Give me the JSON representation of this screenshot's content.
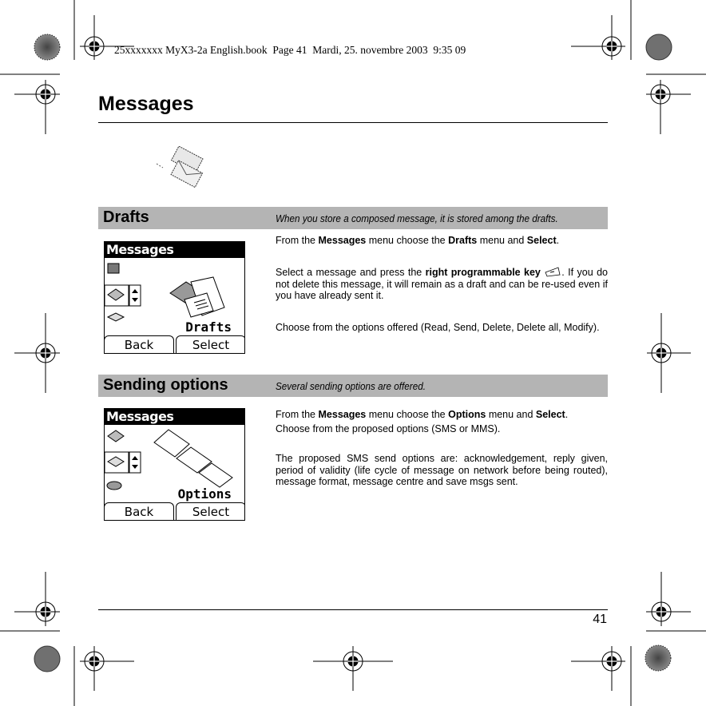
{
  "header_meta": "25xxxxxxx MyX3-2a English.book  Page 41  Mardi, 25. novembre 2003  9:35 09",
  "page_title": "Messages",
  "page_number": "41",
  "sections": [
    {
      "title": "Drafts",
      "description": "When you store a composed message, it is stored among the drafts.",
      "screen": {
        "title": "Messages",
        "label": "Drafts",
        "left_softkey": "Back",
        "right_softkey": "Select"
      },
      "paragraphs": {
        "p1": {
          "a": "From the ",
          "b1": "Messages",
          "c": " menu choose the ",
          "b2": "Drafts",
          "d": " menu and ",
          "b3": "Select",
          "e": "."
        },
        "p2": {
          "a": "Select a message and press the ",
          "b1": "right programmable key",
          "c": ". If you do not delete this message, it will remain as a draft and can be re-used even if you have already sent it."
        },
        "p3": "Choose from the options offered (Read, Send, Delete, Delete all, Modify)."
      }
    },
    {
      "title": "Sending options",
      "description": "Several sending options are offered.",
      "screen": {
        "title": "Messages",
        "label": "Options",
        "left_softkey": "Back",
        "right_softkey": "Select"
      },
      "paragraphs": {
        "p1": {
          "a": "From the ",
          "b1": "Messages",
          "c": " menu choose the ",
          "b2": "Options",
          "d": " menu and ",
          "b3": "Select",
          "e": "."
        },
        "p2": "Choose from the proposed options (SMS or MMS).",
        "p3": "The proposed SMS send options are: acknowledgement, reply given, period of validity (life cycle of message on network before being routed), message format, message centre and save msgs sent."
      }
    }
  ],
  "icons": {
    "chapter_icon": "envelopes-icon",
    "softkey_icon": "right-softkey-icon"
  },
  "colors": {
    "section_bar": "#b4b4b4",
    "screen_header": "#000000"
  }
}
